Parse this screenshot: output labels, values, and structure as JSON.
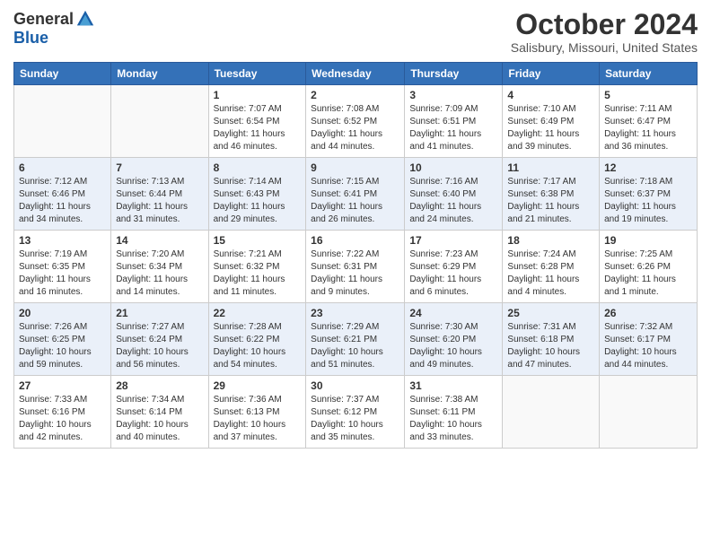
{
  "header": {
    "logo": {
      "general": "General",
      "blue": "Blue",
      "tagline": ""
    },
    "title": "October 2024",
    "location": "Salisbury, Missouri, United States"
  },
  "weekdays": [
    "Sunday",
    "Monday",
    "Tuesday",
    "Wednesday",
    "Thursday",
    "Friday",
    "Saturday"
  ],
  "weeks": [
    [
      {
        "day": "",
        "sunrise": "",
        "sunset": "",
        "daylight": ""
      },
      {
        "day": "",
        "sunrise": "",
        "sunset": "",
        "daylight": ""
      },
      {
        "day": "1",
        "sunrise": "Sunrise: 7:07 AM",
        "sunset": "Sunset: 6:54 PM",
        "daylight": "Daylight: 11 hours and 46 minutes."
      },
      {
        "day": "2",
        "sunrise": "Sunrise: 7:08 AM",
        "sunset": "Sunset: 6:52 PM",
        "daylight": "Daylight: 11 hours and 44 minutes."
      },
      {
        "day": "3",
        "sunrise": "Sunrise: 7:09 AM",
        "sunset": "Sunset: 6:51 PM",
        "daylight": "Daylight: 11 hours and 41 minutes."
      },
      {
        "day": "4",
        "sunrise": "Sunrise: 7:10 AM",
        "sunset": "Sunset: 6:49 PM",
        "daylight": "Daylight: 11 hours and 39 minutes."
      },
      {
        "day": "5",
        "sunrise": "Sunrise: 7:11 AM",
        "sunset": "Sunset: 6:47 PM",
        "daylight": "Daylight: 11 hours and 36 minutes."
      }
    ],
    [
      {
        "day": "6",
        "sunrise": "Sunrise: 7:12 AM",
        "sunset": "Sunset: 6:46 PM",
        "daylight": "Daylight: 11 hours and 34 minutes."
      },
      {
        "day": "7",
        "sunrise": "Sunrise: 7:13 AM",
        "sunset": "Sunset: 6:44 PM",
        "daylight": "Daylight: 11 hours and 31 minutes."
      },
      {
        "day": "8",
        "sunrise": "Sunrise: 7:14 AM",
        "sunset": "Sunset: 6:43 PM",
        "daylight": "Daylight: 11 hours and 29 minutes."
      },
      {
        "day": "9",
        "sunrise": "Sunrise: 7:15 AM",
        "sunset": "Sunset: 6:41 PM",
        "daylight": "Daylight: 11 hours and 26 minutes."
      },
      {
        "day": "10",
        "sunrise": "Sunrise: 7:16 AM",
        "sunset": "Sunset: 6:40 PM",
        "daylight": "Daylight: 11 hours and 24 minutes."
      },
      {
        "day": "11",
        "sunrise": "Sunrise: 7:17 AM",
        "sunset": "Sunset: 6:38 PM",
        "daylight": "Daylight: 11 hours and 21 minutes."
      },
      {
        "day": "12",
        "sunrise": "Sunrise: 7:18 AM",
        "sunset": "Sunset: 6:37 PM",
        "daylight": "Daylight: 11 hours and 19 minutes."
      }
    ],
    [
      {
        "day": "13",
        "sunrise": "Sunrise: 7:19 AM",
        "sunset": "Sunset: 6:35 PM",
        "daylight": "Daylight: 11 hours and 16 minutes."
      },
      {
        "day": "14",
        "sunrise": "Sunrise: 7:20 AM",
        "sunset": "Sunset: 6:34 PM",
        "daylight": "Daylight: 11 hours and 14 minutes."
      },
      {
        "day": "15",
        "sunrise": "Sunrise: 7:21 AM",
        "sunset": "Sunset: 6:32 PM",
        "daylight": "Daylight: 11 hours and 11 minutes."
      },
      {
        "day": "16",
        "sunrise": "Sunrise: 7:22 AM",
        "sunset": "Sunset: 6:31 PM",
        "daylight": "Daylight: 11 hours and 9 minutes."
      },
      {
        "day": "17",
        "sunrise": "Sunrise: 7:23 AM",
        "sunset": "Sunset: 6:29 PM",
        "daylight": "Daylight: 11 hours and 6 minutes."
      },
      {
        "day": "18",
        "sunrise": "Sunrise: 7:24 AM",
        "sunset": "Sunset: 6:28 PM",
        "daylight": "Daylight: 11 hours and 4 minutes."
      },
      {
        "day": "19",
        "sunrise": "Sunrise: 7:25 AM",
        "sunset": "Sunset: 6:26 PM",
        "daylight": "Daylight: 11 hours and 1 minute."
      }
    ],
    [
      {
        "day": "20",
        "sunrise": "Sunrise: 7:26 AM",
        "sunset": "Sunset: 6:25 PM",
        "daylight": "Daylight: 10 hours and 59 minutes."
      },
      {
        "day": "21",
        "sunrise": "Sunrise: 7:27 AM",
        "sunset": "Sunset: 6:24 PM",
        "daylight": "Daylight: 10 hours and 56 minutes."
      },
      {
        "day": "22",
        "sunrise": "Sunrise: 7:28 AM",
        "sunset": "Sunset: 6:22 PM",
        "daylight": "Daylight: 10 hours and 54 minutes."
      },
      {
        "day": "23",
        "sunrise": "Sunrise: 7:29 AM",
        "sunset": "Sunset: 6:21 PM",
        "daylight": "Daylight: 10 hours and 51 minutes."
      },
      {
        "day": "24",
        "sunrise": "Sunrise: 7:30 AM",
        "sunset": "Sunset: 6:20 PM",
        "daylight": "Daylight: 10 hours and 49 minutes."
      },
      {
        "day": "25",
        "sunrise": "Sunrise: 7:31 AM",
        "sunset": "Sunset: 6:18 PM",
        "daylight": "Daylight: 10 hours and 47 minutes."
      },
      {
        "day": "26",
        "sunrise": "Sunrise: 7:32 AM",
        "sunset": "Sunset: 6:17 PM",
        "daylight": "Daylight: 10 hours and 44 minutes."
      }
    ],
    [
      {
        "day": "27",
        "sunrise": "Sunrise: 7:33 AM",
        "sunset": "Sunset: 6:16 PM",
        "daylight": "Daylight: 10 hours and 42 minutes."
      },
      {
        "day": "28",
        "sunrise": "Sunrise: 7:34 AM",
        "sunset": "Sunset: 6:14 PM",
        "daylight": "Daylight: 10 hours and 40 minutes."
      },
      {
        "day": "29",
        "sunrise": "Sunrise: 7:36 AM",
        "sunset": "Sunset: 6:13 PM",
        "daylight": "Daylight: 10 hours and 37 minutes."
      },
      {
        "day": "30",
        "sunrise": "Sunrise: 7:37 AM",
        "sunset": "Sunset: 6:12 PM",
        "daylight": "Daylight: 10 hours and 35 minutes."
      },
      {
        "day": "31",
        "sunrise": "Sunrise: 7:38 AM",
        "sunset": "Sunset: 6:11 PM",
        "daylight": "Daylight: 10 hours and 33 minutes."
      },
      {
        "day": "",
        "sunrise": "",
        "sunset": "",
        "daylight": ""
      },
      {
        "day": "",
        "sunrise": "",
        "sunset": "",
        "daylight": ""
      }
    ]
  ]
}
